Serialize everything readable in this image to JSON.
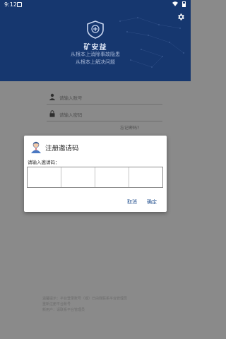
{
  "status": {
    "time": "9:12"
  },
  "brand": {
    "name": "矿安益"
  },
  "slogan": {
    "line1": "从根本上消除事故隐患",
    "line2": "从根本上解决问题"
  },
  "form": {
    "account_placeholder": "请输入账号",
    "password_placeholder": "请输入密码",
    "forgot_label": "忘记密码?"
  },
  "footer": {
    "line1": "温馨提示：平台登录账号（或）已由我联系平台管理员",
    "line2": "重新注册平台账号",
    "line3": "新用户：请联系平台管理员"
  },
  "dialog": {
    "title": "注册邀请码",
    "label": "请输入邀请码：",
    "cancel": "取消",
    "confirm": "确定",
    "code_cells": 4
  },
  "colors": {
    "header": "#16376f",
    "accent": "#1f4d8d",
    "overlay": "#8a8a8a"
  },
  "icons": [
    "settings-icon",
    "user-icon",
    "lock-icon",
    "avatar-icon",
    "shield-logo-icon"
  ]
}
